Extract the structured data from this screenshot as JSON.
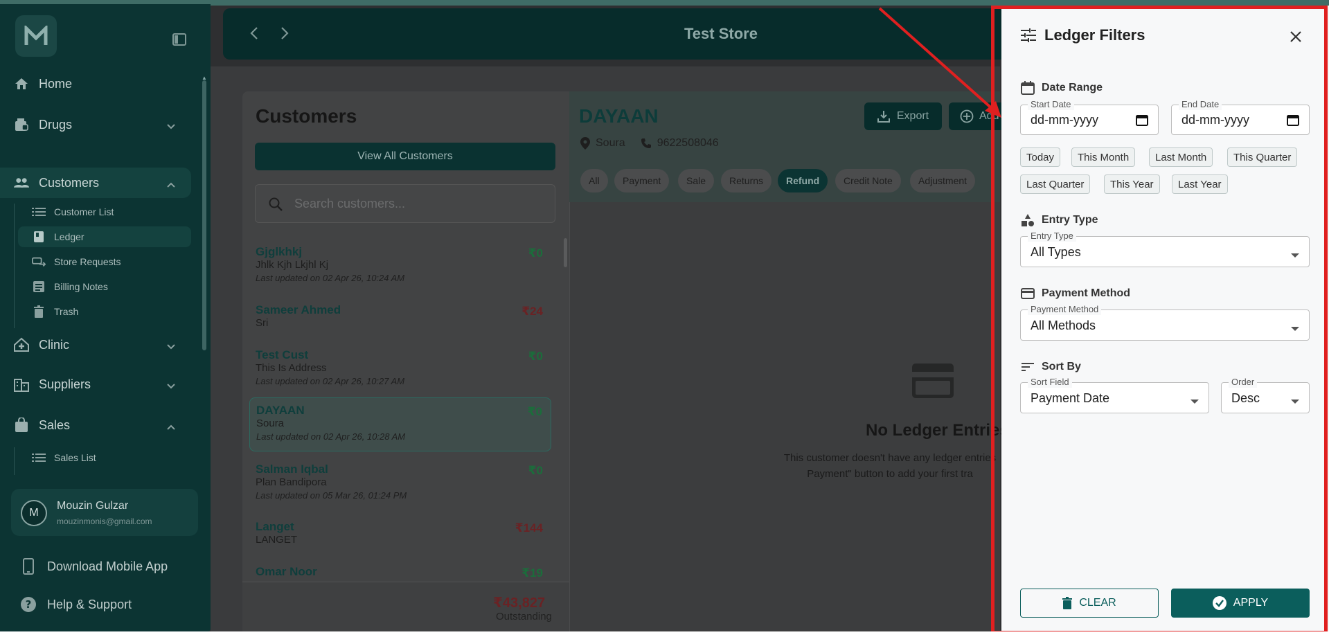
{
  "colors": {
    "accent": "#0b5e5c",
    "sidebar_bg": "#0c3433",
    "drawer_bg": "#f7f8f9",
    "annotation": "#e02020"
  },
  "sidebar": {
    "logo": "M",
    "items": [
      {
        "label": "Home",
        "icon": "home-icon"
      },
      {
        "label": "Drugs",
        "icon": "drugs-icon"
      },
      {
        "label": "Customers",
        "icon": "customers-icon"
      },
      {
        "label": "Clinic",
        "icon": "clinic-icon"
      },
      {
        "label": "Suppliers",
        "icon": "suppliers-icon"
      },
      {
        "label": "Sales",
        "icon": "sales-icon"
      }
    ],
    "customer_sub": [
      {
        "label": "Customer List",
        "icon": "list-icon"
      },
      {
        "label": "Ledger",
        "icon": "book-icon"
      },
      {
        "label": "Store Requests",
        "icon": "request-icon"
      },
      {
        "label": "Billing Notes",
        "icon": "notes-icon"
      },
      {
        "label": "Trash",
        "icon": "trash-icon"
      }
    ],
    "sales_sub": [
      {
        "label": "Sales List",
        "icon": "list-icon"
      }
    ],
    "user": {
      "initial": "M",
      "name": "Mouzin Gulzar",
      "email": "mouzinmonis@gmail.com"
    },
    "download": "Download Mobile App",
    "help": "Help & Support"
  },
  "topbar": {
    "title": "Test Store"
  },
  "customers": {
    "title": "Customers",
    "view_all": "View All Customers",
    "search_placeholder": "Search customers...",
    "rows": [
      {
        "name": "Gjglkhkj",
        "address": "Jhlk Kjh Lkjhl Kj",
        "updated": "Last updated on 02 Apr 26, 10:24 AM",
        "amount": "₹0",
        "tone": "green"
      },
      {
        "name": "Sameer Ahmed",
        "address": "Sri",
        "updated": "",
        "amount": "₹24",
        "tone": "red"
      },
      {
        "name": "Test Cust",
        "address": "This Is Address",
        "updated": "Last updated on 02 Apr 26, 10:27 AM",
        "amount": "₹0",
        "tone": "green"
      },
      {
        "name": "DAYAAN",
        "address": "Soura",
        "updated": "Last updated on 02 Apr 26, 10:28 AM",
        "amount": "₹0",
        "tone": "green"
      },
      {
        "name": "Salman Iqbal",
        "address": "Plan Bandipora",
        "updated": "Last updated on 05 Mar 26, 01:24 PM",
        "amount": "₹0",
        "tone": "green"
      },
      {
        "name": "Langet",
        "address": "LANGET",
        "updated": "",
        "amount": "₹144",
        "tone": "red"
      },
      {
        "name": "Omar Noor",
        "address": "",
        "updated": "",
        "amount": "₹19",
        "tone": "green"
      }
    ],
    "total": "₹43,827",
    "total_label": "Outstanding"
  },
  "ledger": {
    "name": "DAYAAN",
    "location": "Soura",
    "phone": "9622508046",
    "export": "Export",
    "add": "Add",
    "chips": [
      "All",
      "Payment",
      "Sale",
      "Returns",
      "Refund",
      "Credit Note",
      "Adjustment"
    ],
    "active_chip": "Refund",
    "empty_title": "No Ledger Entries",
    "empty_line1": "This customer doesn't have any ledger entries",
    "empty_line2": "Payment\" button to add your first tra"
  },
  "drawer": {
    "title": "Ledger Filters",
    "date_range": {
      "title": "Date Range",
      "start_label": "Start Date",
      "start_value": "dd-mm-yyyy",
      "end_label": "End Date",
      "end_value": "dd-mm-yyyy",
      "quick": [
        "Today",
        "This Month",
        "Last Month",
        "This Quarter",
        "Last Quarter",
        "This Year",
        "Last Year"
      ]
    },
    "entry_type": {
      "title": "Entry Type",
      "label": "Entry Type",
      "value": "All Types"
    },
    "payment_method": {
      "title": "Payment Method",
      "label": "Payment Method",
      "value": "All Methods"
    },
    "sort": {
      "title": "Sort By",
      "field_label": "Sort Field",
      "field_value": "Payment Date",
      "order_label": "Order",
      "order_value": "Desc"
    },
    "clear": "CLEAR",
    "apply": "APPLY"
  }
}
